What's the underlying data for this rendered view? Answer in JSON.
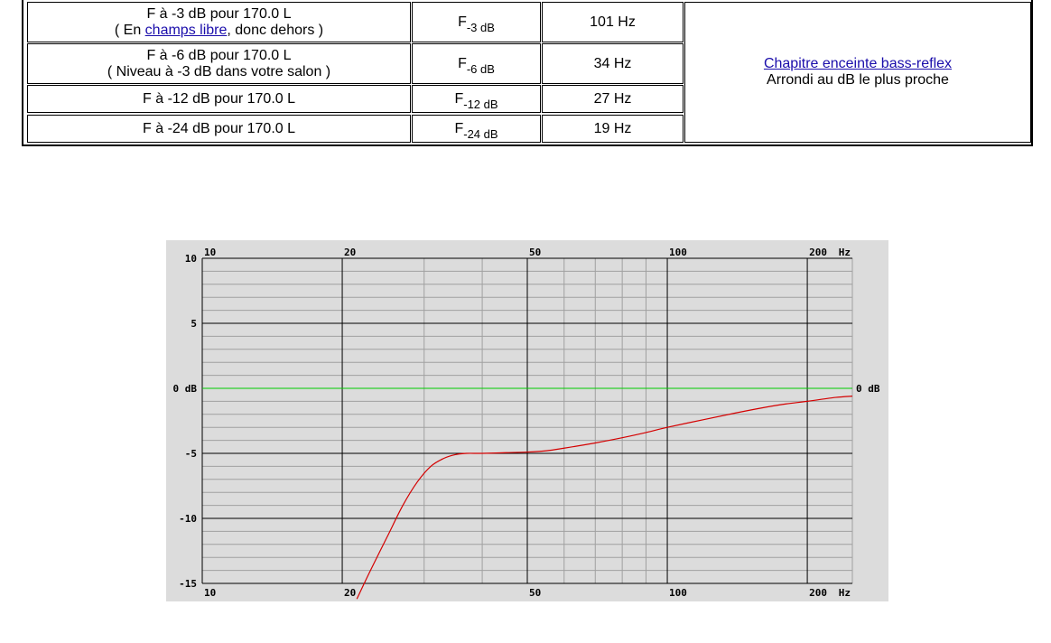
{
  "table": {
    "rows": [
      {
        "line1": "F à -3 dB pour 170.0 L",
        "line2_pre": "( En ",
        "line2_link": "champs libre",
        "line2_post": ", donc dehors )",
        "symbol": "F",
        "symbol_sub": "-3 dB",
        "value": "101 Hz"
      },
      {
        "line1": "F à -6 dB pour 170.0 L",
        "line2": "( Niveau à -3 dB dans votre salon )",
        "symbol": "F",
        "symbol_sub": "-6 dB",
        "value": "34 Hz"
      },
      {
        "line1": "F à -12 dB pour 170.0 L",
        "symbol": "F",
        "symbol_sub": "-12 dB",
        "value": "27 Hz"
      },
      {
        "line1": "F à -24 dB pour 170.0 L",
        "symbol": "F",
        "symbol_sub": "-24 dB",
        "value": "19 Hz"
      }
    ],
    "side": {
      "link": "Chapitre enceinte bass-reflex",
      "note": "Arrondi au dB le plus proche"
    }
  },
  "chart_data": {
    "type": "line",
    "title": "",
    "xlabel": "",
    "ylabel": "",
    "x_scale": "log",
    "xlim": [
      10,
      250
    ],
    "ylim": [
      -15,
      10
    ],
    "x_ticks": [
      10,
      20,
      50,
      100,
      200
    ],
    "x_tick_labels": [
      "10",
      "20",
      "50",
      "100",
      "200"
    ],
    "x_unit_label": "Hz",
    "y_ticks": [
      10,
      5,
      0,
      -5,
      -10,
      -15
    ],
    "y_tick_labels": [
      "10",
      "5",
      "0 dB",
      "-5",
      "-10",
      "-15"
    ],
    "right_label": "0 dB",
    "grid": true,
    "reference_line": {
      "y": 0,
      "color": "#00cc00"
    },
    "series": [
      {
        "color": "#d40000",
        "x": [
          21.5,
          23,
          25,
          27,
          29,
          31,
          33,
          35,
          37,
          40,
          45,
          50,
          55,
          60,
          70,
          80,
          90,
          100,
          120,
          140,
          160,
          180,
          200,
          230,
          250
        ],
        "y": [
          -16.2,
          -14.0,
          -11.4,
          -9.0,
          -7.2,
          -6.0,
          -5.4,
          -5.1,
          -5.0,
          -5.0,
          -4.95,
          -4.9,
          -4.8,
          -4.6,
          -4.2,
          -3.8,
          -3.4,
          -3.0,
          -2.4,
          -1.9,
          -1.5,
          -1.2,
          -1.0,
          -0.7,
          -0.6
        ]
      }
    ]
  }
}
